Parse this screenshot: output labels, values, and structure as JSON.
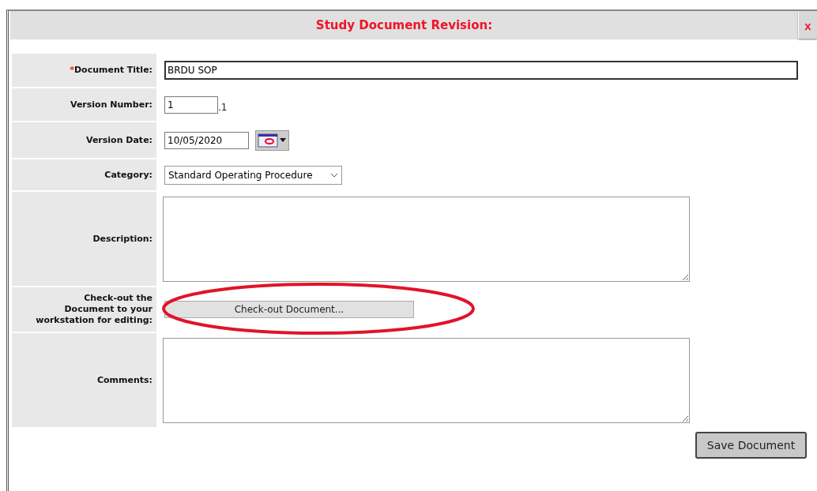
{
  "dialog": {
    "title": "Study Document Revision:",
    "close": "x"
  },
  "fields": [
    {
      "kind": "text",
      "label": "Document Title:",
      "marker": "*",
      "value": "BRDU SOP"
    },
    {
      "kind": "version",
      "label": "Version Number:",
      "value": "1",
      "suffix": ".1"
    },
    {
      "kind": "date",
      "label": "Version Date:",
      "value": "10/05/2020"
    },
    {
      "kind": "select",
      "label": "Category:",
      "value": "Standard Operating Procedure"
    },
    {
      "kind": "textarea",
      "label": "Description:"
    },
    {
      "kind": "button",
      "label": "Check-out the Document to your workstation for editing:",
      "button": "Check-out Document...",
      "highlighted": true
    },
    {
      "kind": "textarea",
      "label": "Comments:"
    }
  ],
  "save_button": "Save Document"
}
